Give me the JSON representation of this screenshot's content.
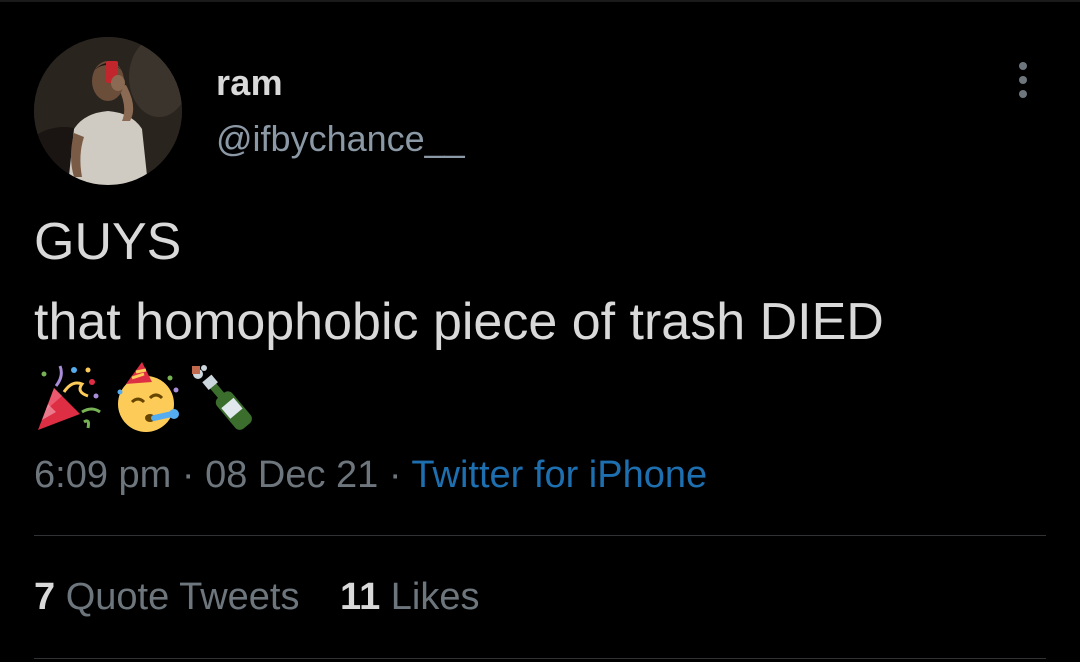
{
  "author": {
    "display_name": "ram",
    "handle": "@ifbychance__"
  },
  "tweet": {
    "lines": [
      "GUYS",
      "that homophobic piece of trash DIED"
    ],
    "emojis": [
      "party-popper",
      "partying-face",
      "champagne"
    ]
  },
  "meta": {
    "time": "6:09 pm",
    "separator": "·",
    "date": "08 Dec 21",
    "source": "Twitter for iPhone"
  },
  "stats": {
    "quote_tweets": {
      "count": "7",
      "label": "Quote Tweets"
    },
    "likes": {
      "count": "11",
      "label": "Likes"
    }
  },
  "colors": {
    "background": "#000000",
    "text": "#d9d9d9",
    "muted": "#6e767d",
    "link": "#1d6fb0"
  }
}
